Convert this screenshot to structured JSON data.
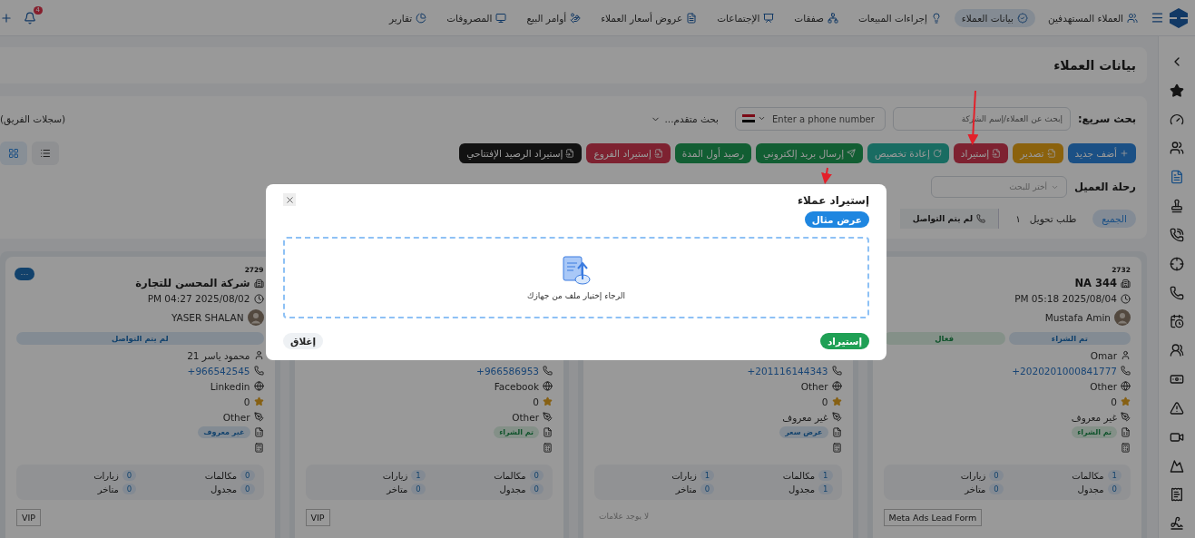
{
  "nav": {
    "items": [
      {
        "label": "العملاء المستهدفين",
        "selected": false
      },
      {
        "label": "بيانات العملاء",
        "selected": true
      },
      {
        "label": "إجراءات المبيعات",
        "selected": false
      },
      {
        "label": "صفقات",
        "selected": false
      },
      {
        "label": "الإجتماعات",
        "selected": false
      },
      {
        "label": "عروض أسعار العملاء",
        "selected": false
      },
      {
        "label": "أوامر البيع",
        "selected": false
      },
      {
        "label": "المصروفات",
        "selected": false
      },
      {
        "label": "تقارير",
        "selected": false
      }
    ],
    "notifications": "4"
  },
  "sidebar": [
    {
      "selected": false
    },
    {
      "selected": false
    },
    {
      "selected": false
    },
    {
      "selected": false
    },
    {
      "selected": true
    },
    {
      "selected": false
    },
    {
      "selected": false
    },
    {
      "selected": false
    },
    {
      "selected": false
    },
    {
      "selected": false
    },
    {
      "selected": false
    },
    {
      "selected": false
    },
    {
      "selected": false
    },
    {
      "selected": false
    },
    {
      "selected": false
    },
    {
      "selected": false
    },
    {
      "selected": false
    }
  ],
  "page_title": "بيانات العملاء",
  "search": {
    "label": "بحث سريع:",
    "placeholder": "إبحث عن العملاء/إسم الشركة",
    "phone_placeholder": "Enter a phone number",
    "advanced": "بحث متقدم...",
    "team_records": "(سجلات الفريق)"
  },
  "actions": [
    {
      "label": "أضف جديد",
      "kind": "primary"
    },
    {
      "label": "تصدير",
      "kind": "warning"
    },
    {
      "label": "إستيراد",
      "kind": "danger"
    },
    {
      "label": "إعادة تخصيص",
      "kind": "info"
    },
    {
      "label": "إرسال بريد إلكتروني",
      "kind": "success"
    },
    {
      "label": "رصيد أول المدة",
      "kind": "success"
    },
    {
      "label": "إستيراد الفروع",
      "kind": "danger"
    },
    {
      "label": "إستيراد الرصيد الإفتتاحي",
      "kind": "dark"
    }
  ],
  "view_toggle": [
    {
      "selected": false
    },
    {
      "selected": true
    }
  ],
  "journey": {
    "label": "رحلة العميل",
    "placeholder": "أختر للبحث"
  },
  "stages": [
    {
      "label": "الجميع",
      "selected": true
    },
    {
      "label": "طلب تحويل",
      "count": "١",
      "selected": false
    },
    {
      "label": "لم يتم التواصل",
      "selected": false
    }
  ],
  "cards": [
    {
      "id": "2732",
      "company": "NA 344",
      "date": "PM 05:18 2025/08/04",
      "owner": "Mustafa Amin",
      "statuses": [
        {
          "label": "تم الشراء",
          "kind": "info"
        },
        {
          "label": "فعال",
          "kind": "success"
        }
      ],
      "contact": "Omar",
      "phone": "+2020201000841777",
      "source": "Other",
      "rating": "0",
      "type": "غير معروف",
      "tag": {
        "label": "تم الشراء",
        "kind": "success"
      },
      "stats": [
        {
          "label": "مكالمات",
          "value": "1"
        },
        {
          "label": "زيارات",
          "value": "0"
        },
        {
          "label": "مجدول",
          "value": "0"
        },
        {
          "label": "متاخر",
          "value": "0"
        }
      ],
      "footer": {
        "kind": "label",
        "text": "Meta Ads Lead Form"
      }
    },
    {
      "phone": "+201116144343",
      "source": "Other",
      "rating": "0",
      "type": "غير معروف",
      "tag": {
        "label": "عرض سعر",
        "kind": "info"
      },
      "stats": [
        {
          "label": "مكالمات",
          "value": "1"
        },
        {
          "label": "زيارات",
          "value": "1"
        },
        {
          "label": "مجدول",
          "value": "1"
        },
        {
          "label": "متاخر",
          "value": "0"
        }
      ],
      "footer": {
        "kind": "note",
        "text": "لا يوجد علامات"
      }
    },
    {
      "phone": "+966586953",
      "source": "Facebook",
      "rating": "0",
      "type": "Other",
      "tag": {
        "label": "تم الشراء",
        "kind": "success"
      },
      "stats": [
        {
          "label": "مكالمات",
          "value": "0"
        },
        {
          "label": "زيارات",
          "value": "1"
        },
        {
          "label": "مجدول",
          "value": "0"
        },
        {
          "label": "متاخر",
          "value": "0"
        }
      ],
      "footer": {
        "kind": "label",
        "text": "VIP"
      }
    },
    {
      "id": "2729",
      "menu": "···",
      "company": "شركة المحسن للتجارة",
      "date": "PM 04:27 2025/08/02",
      "owner": "YASER SHALAN",
      "statuses": [
        {
          "label": "لم يتم التواصل",
          "kind": "info"
        }
      ],
      "contact": "محمود ياسر 21",
      "phone": "+966542545",
      "source": "Linkedin",
      "rating": "0",
      "type": "Other",
      "tag": {
        "label": "غير معروف",
        "kind": "info"
      },
      "stats": [
        {
          "label": "مكالمات",
          "value": "0"
        },
        {
          "label": "زيارات",
          "value": "0"
        },
        {
          "label": "مجدول",
          "value": "0"
        },
        {
          "label": "متاخر",
          "value": "0"
        }
      ],
      "footer": {
        "kind": "label",
        "text": "VIP"
      }
    }
  ],
  "modal": {
    "title": "إستيراد عملاء",
    "example_button": "عرض مثال",
    "dropzone_text": "الرجاء إختيار ملف من جهازك",
    "import_button": "إستيراد",
    "close_button": "إغلاق"
  }
}
